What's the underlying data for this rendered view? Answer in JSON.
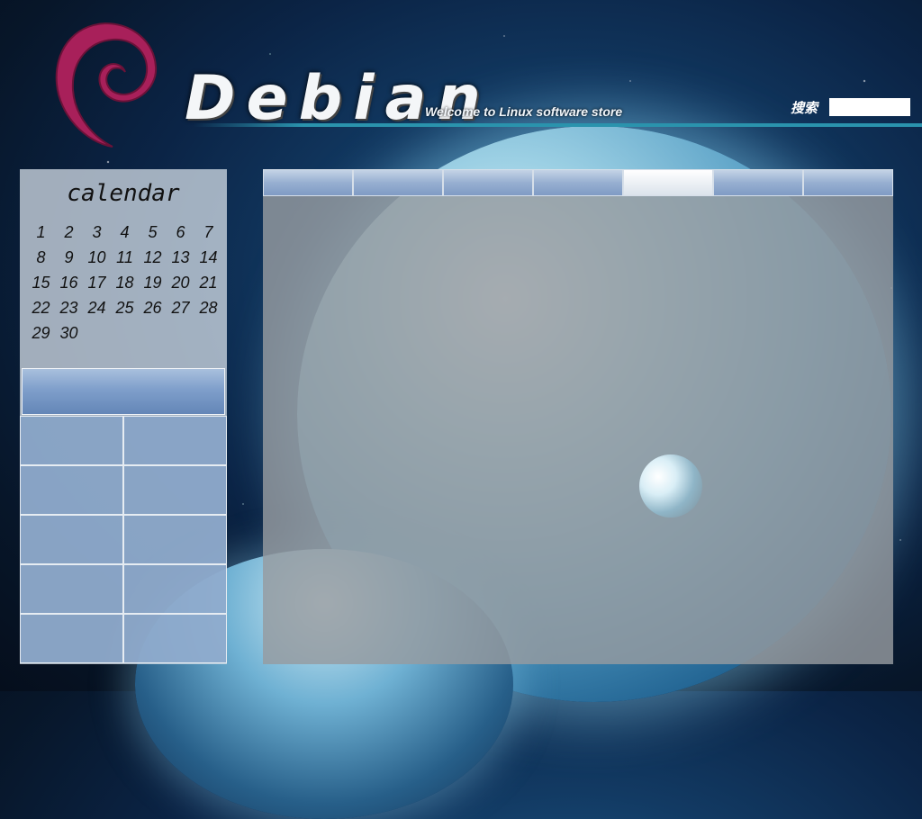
{
  "header": {
    "brand": "Debian",
    "welcome": "Welcome to Linux software store",
    "search_label": "搜索",
    "search_value": ""
  },
  "calendar": {
    "title": "calendar",
    "days": [
      1,
      2,
      3,
      4,
      5,
      6,
      7,
      8,
      9,
      10,
      11,
      12,
      13,
      14,
      15,
      16,
      17,
      18,
      19,
      20,
      21,
      22,
      23,
      24,
      25,
      26,
      27,
      28,
      29,
      30
    ]
  },
  "tabs": [
    {
      "label": "",
      "active": false
    },
    {
      "label": "",
      "active": false
    },
    {
      "label": "",
      "active": false
    },
    {
      "label": "",
      "active": false
    },
    {
      "label": "",
      "active": true
    },
    {
      "label": "",
      "active": false
    },
    {
      "label": "",
      "active": false
    }
  ],
  "categories": {
    "header": "",
    "items": [
      "",
      "",
      "",
      "",
      "",
      "",
      "",
      "",
      "",
      ""
    ]
  },
  "colors": {
    "accent_line": "#2a93ad",
    "logo_swirl": "#a8205a",
    "tab_blue": "#8aa6cc"
  }
}
